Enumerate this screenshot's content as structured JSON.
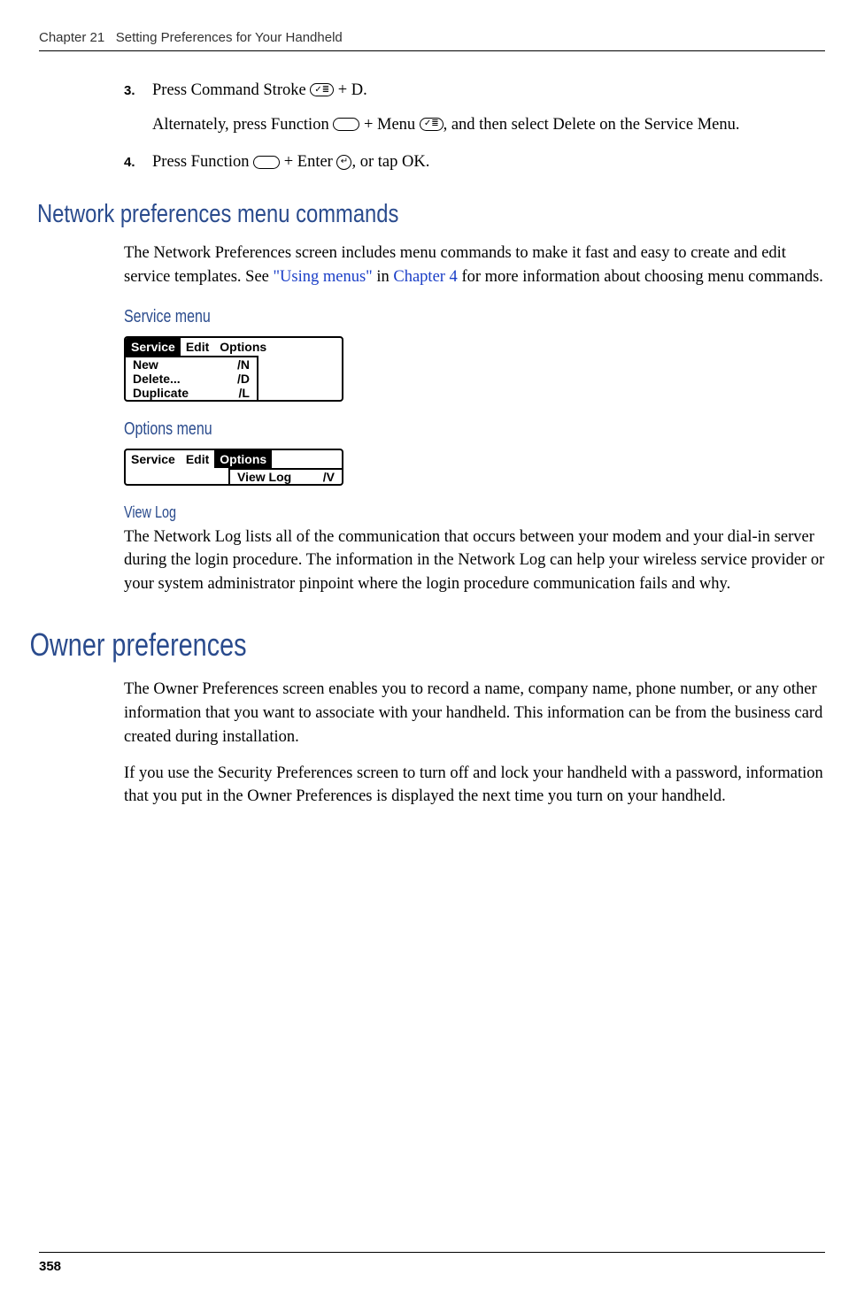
{
  "header": {
    "chapter": "Chapter 21",
    "title": "Setting Preferences for Your Handheld"
  },
  "steps": {
    "s3": {
      "num": "3.",
      "line1a": "Press Command Stroke ",
      "line1b": " + D.",
      "line2a": "Alternately, press Function ",
      "line2b": " + Menu ",
      "line2c": ", and then select Delete on the Service Menu."
    },
    "s4": {
      "num": "4.",
      "line1a": "Press Function ",
      "line1b": " + Enter ",
      "line1c": ", or tap OK."
    }
  },
  "section1": {
    "heading": "Network preferences menu commands",
    "para_a": "The Network Preferences screen includes menu commands to make it fast and easy to create and edit service templates. See ",
    "link1": "\"Using menus\"",
    "para_b": " in ",
    "link2": "Chapter 4",
    "para_c": " for more information about choosing menu commands.",
    "service_heading": "Service menu",
    "options_heading": "Options menu",
    "viewlog_heading": "View Log",
    "viewlog_para": "The Network Log lists all of the communication that occurs between your modem and your dial-in server during the login procedure. The information in the Network Log can help your wireless service provider or your system administrator pinpoint where the login procedure communication fails and why."
  },
  "menus": {
    "service": {
      "tabs": [
        "Service",
        "Edit",
        "Options"
      ],
      "items": [
        {
          "label": "New",
          "shortcut": "/N"
        },
        {
          "label": "Delete...",
          "shortcut": "/D"
        },
        {
          "label": "Duplicate",
          "shortcut": "/L"
        }
      ]
    },
    "options": {
      "tabs": [
        "Service",
        "Edit",
        "Options"
      ],
      "items": [
        {
          "label": "View Log",
          "shortcut": "/V"
        }
      ]
    }
  },
  "section2": {
    "heading": "Owner preferences",
    "para1": "The Owner Preferences screen enables you to record a name, company name, phone number, or any other information that you want to associate with your handheld. This information can be from the business card created during installation.",
    "para2": "If you use the Security Preferences screen to turn off and lock your handheld with a password, information that you put in the Owner Preferences is displayed the next time you turn on your handheld."
  },
  "icons": {
    "command_stroke": "✓≣",
    "function": " ",
    "menu": "✓≣",
    "enter": "↵"
  },
  "page_number": "358"
}
